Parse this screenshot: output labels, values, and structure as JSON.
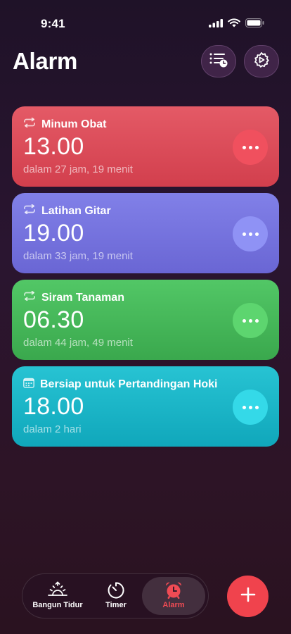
{
  "status_bar": {
    "time": "9:41"
  },
  "header": {
    "title": "Alarm",
    "list_button_icon": "list-clock-icon",
    "settings_button_icon": "gear-icon"
  },
  "alarms": [
    {
      "label": "Minum Obat",
      "time": "13.00",
      "subtitle": "dalam 27 jam, 19 menit",
      "type_icon": "repeat-icon",
      "color": "#d84652"
    },
    {
      "label": "Latihan Gitar",
      "time": "19.00",
      "subtitle": "dalam 33 jam, 19 menit",
      "type_icon": "repeat-icon",
      "color": "#7371dc"
    },
    {
      "label": "Siram Tanaman",
      "time": "06.30",
      "subtitle": "dalam 44 jam, 49 menit",
      "type_icon": "repeat-icon",
      "color": "#45b657"
    },
    {
      "label": "Bersiap untuk Pertandingan Hoki",
      "time": "18.00",
      "subtitle": "dalam 2 hari",
      "type_icon": "calendar-icon",
      "color": "#18b3c6"
    }
  ],
  "tabbar": {
    "tabs": [
      {
        "label": "Bangun Tidur",
        "icon": "sunrise-icon"
      },
      {
        "label": "Timer",
        "icon": "timer-icon"
      },
      {
        "label": "Alarm",
        "icon": "alarm-clock-icon",
        "selected": true
      }
    ],
    "accent": "#f04b54"
  },
  "fab": {
    "label": "+",
    "icon": "plus-icon"
  }
}
